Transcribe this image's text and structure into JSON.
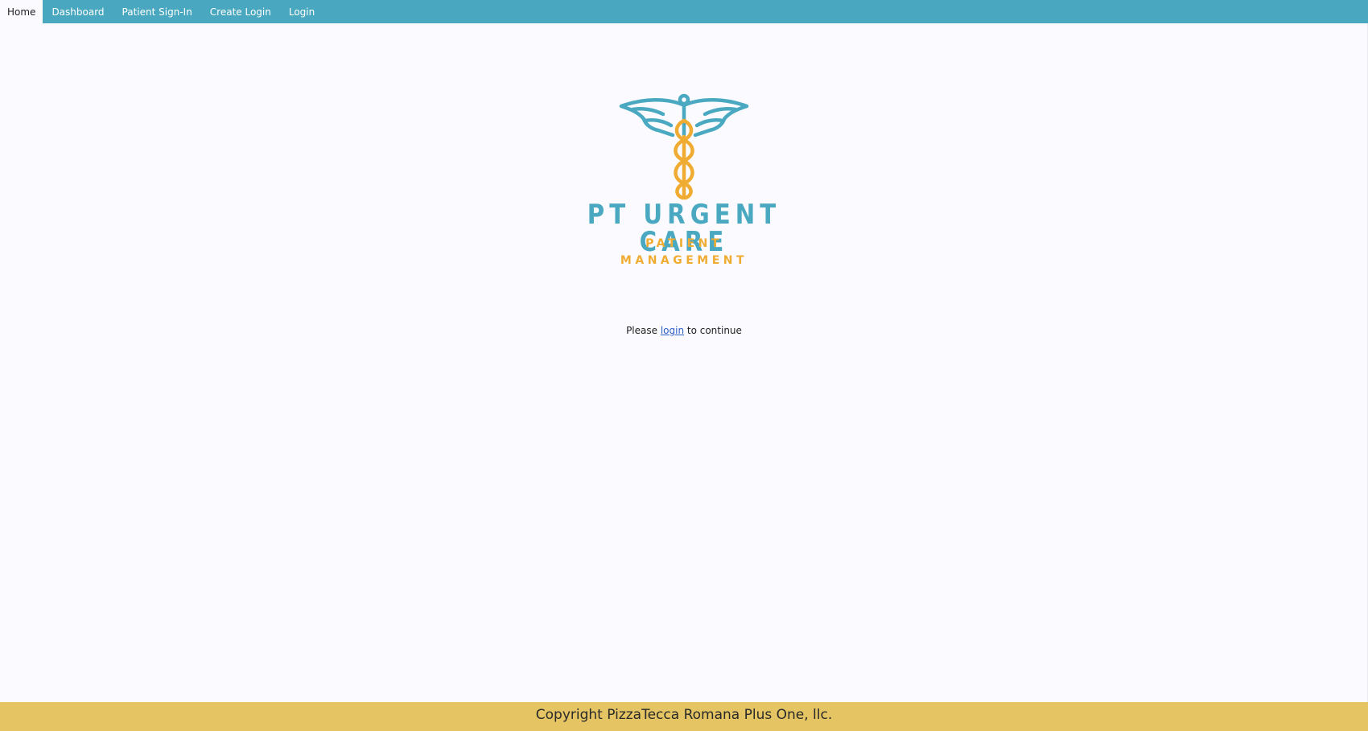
{
  "nav": {
    "items": [
      {
        "label": "Home",
        "active": true
      },
      {
        "label": "Dashboard",
        "active": false
      },
      {
        "label": "Patient Sign-In",
        "active": false
      },
      {
        "label": "Create Login",
        "active": false
      },
      {
        "label": "Login",
        "active": false
      }
    ],
    "color": "#49a8c0"
  },
  "logo": {
    "icon": "caduceus-icon",
    "title": "PT URGENT CARE",
    "subtitle_line1": "PATIENT",
    "subtitle_line2": "MANAGEMENT",
    "primary_color": "#4aa9c1",
    "secondary_color": "#f0ac32"
  },
  "message": {
    "prefix": "Please ",
    "link": "login",
    "suffix": " to continue"
  },
  "footer": {
    "text": "Copyright PizzaTecca Romana Plus One, llc.",
    "color": "#e4c463"
  }
}
